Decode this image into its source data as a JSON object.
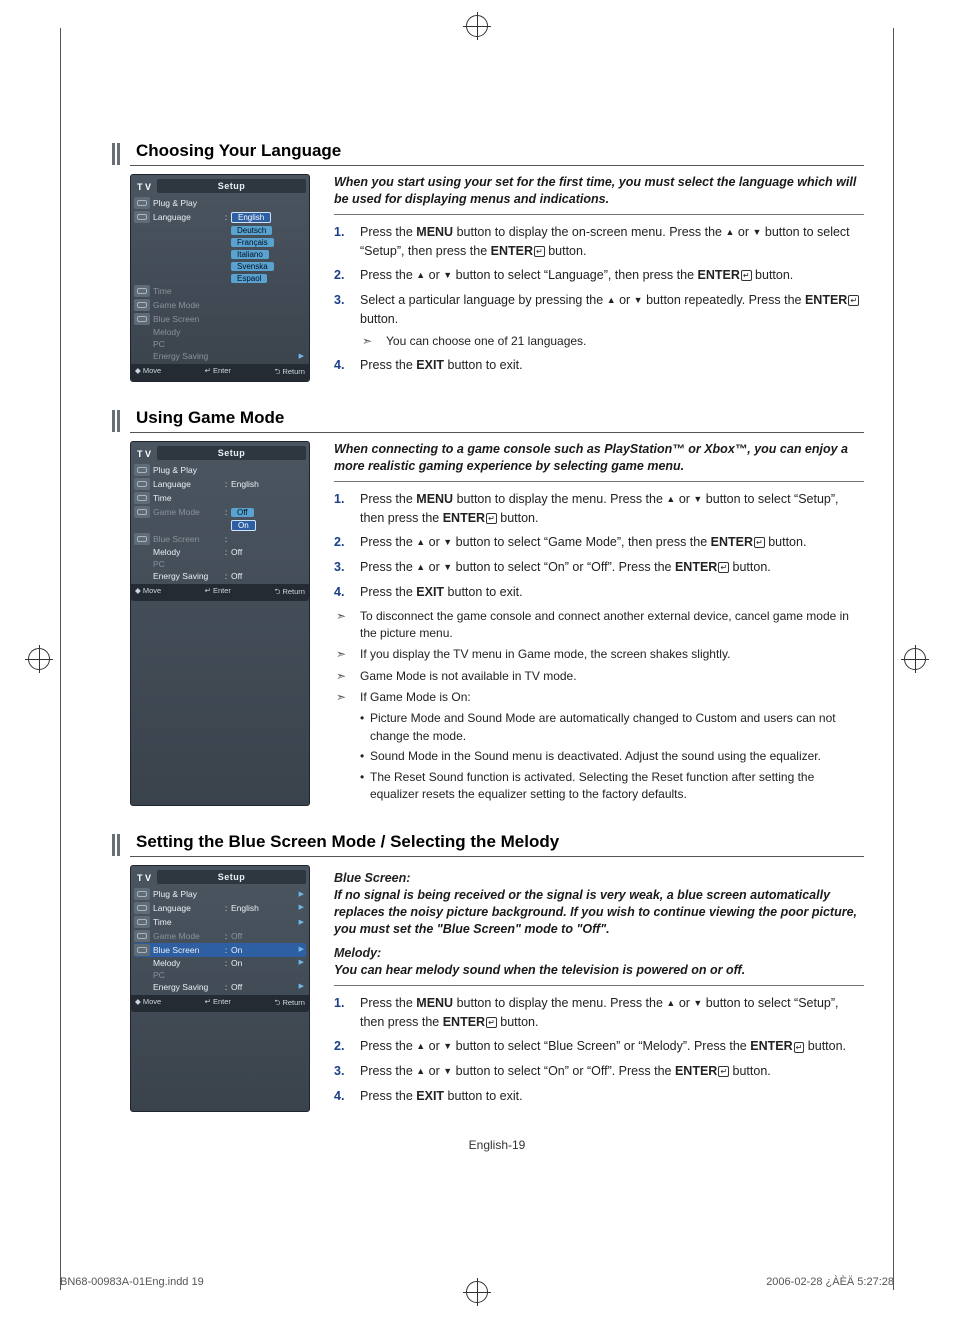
{
  "page_number_label": "English-19",
  "footer_left": "BN68-00983A-01Eng.indd   19",
  "footer_right": "2006-02-28   ¿ÀÈÄ 5:27:28",
  "sectionA": {
    "title": "Choosing Your Language",
    "intro": "When you start using your set for the first time, you must select the language which will be used for displaying menus and indications.",
    "steps": [
      "Press the <b>MENU</b> button to display the on-screen menu. Press the <span class='arw'>▲</span> or <span class='arw'>▼</span> button to select “Setup”, then press the <b>ENTER</b><span class='enter-ic'>↵</span> button.",
      "Press the <span class='arw'>▲</span> or <span class='arw'>▼</span> button to select “Language”, then press the <b>ENTER</b><span class='enter-ic'>↵</span> button.",
      "Select a particular language by pressing the <span class='arw'>▲</span> or <span class='arw'>▼</span> button repeatedly. Press the <b>ENTER</b><span class='enter-ic'>↵</span> button.<div class='note-line'>You can choose one of 21 languages.</div>",
      "Press the <b>EXIT</b> button to exit."
    ],
    "osd": {
      "tv": "T V",
      "header": "Setup",
      "rows": [
        {
          "label": "Plug & Play"
        },
        {
          "label": "Language",
          "col": ":",
          "options": [
            "English",
            "Deutsch",
            "Français",
            "Italiano",
            "Svenska",
            "Espaol"
          ],
          "selected": 0,
          "optionsMode": true
        },
        {
          "label": "Time",
          "dim": true
        },
        {
          "label": "Game Mode",
          "dim": true
        },
        {
          "label": "Blue Screen",
          "dim": true
        },
        {
          "label": "Melody",
          "dim": true
        },
        {
          "label": "PC",
          "dim": true
        },
        {
          "label": "Energy Saving",
          "dim": true,
          "chev": true
        }
      ],
      "foot": [
        "◆ Move",
        "↵ Enter",
        "⮌ Return"
      ]
    }
  },
  "sectionB": {
    "title": "Using Game Mode",
    "intro": "When connecting to a game console such as PlayStation™ or Xbox™, you can enjoy a more realistic gaming experience by selecting game menu.",
    "steps": [
      "Press the <b>MENU</b> button to display the menu. Press the <span class='arw'>▲</span> or <span class='arw'>▼</span> button to select “Setup”, then press the <b>ENTER</b><span class='enter-ic'>↵</span> button.",
      "Press the <span class='arw'>▲</span> or <span class='arw'>▼</span> button to select “Game Mode”, then press the <b>ENTER</b><span class='enter-ic'>↵</span> button.",
      "Press the <span class='arw'>▲</span> or <span class='arw'>▼</span> button to select “On” or “Off”. Press the <b>ENTER</b><span class='enter-ic'>↵</span> button.",
      "Press the <b>EXIT</b> button to exit."
    ],
    "notes": [
      "To disconnect the game console and connect another external device, cancel game mode in the picture menu.",
      "If you display the TV menu in Game mode, the screen shakes slightly.",
      "Game Mode is not available in TV mode.",
      "If Game Mode is On:"
    ],
    "sub_bullets": [
      "Picture Mode and Sound Mode are automatically changed to Custom and users can not change the mode.",
      "Sound Mode in the Sound menu is deactivated. Adjust the sound using the equalizer.",
      "The Reset Sound function is activated. Selecting the Reset function after setting the equalizer resets the equalizer setting to the factory defaults."
    ],
    "osd": {
      "tv": "T V",
      "header": "Setup",
      "rows": [
        {
          "label": "Plug & Play"
        },
        {
          "label": "Language",
          "col": ":",
          "val": "English"
        },
        {
          "label": "Time"
        },
        {
          "label": "Game Mode",
          "col": ":",
          "options": [
            "Off",
            "On"
          ],
          "selected": 1,
          "optionsMode": true,
          "labelDim": true
        },
        {
          "label": "Blue Screen",
          "col": ":",
          "dim": true
        },
        {
          "label": "Melody",
          "col": ":",
          "val": "Off"
        },
        {
          "label": "PC",
          "dim": true
        },
        {
          "label": "Energy Saving",
          "col": ":",
          "val": "Off"
        }
      ],
      "foot": [
        "◆ Move",
        "↵ Enter",
        "⮌ Return"
      ]
    }
  },
  "sectionC": {
    "title": "Setting the Blue Screen Mode / Selecting the Melody",
    "intro_title_1": "Blue Screen:",
    "intro_1": "If no signal is being received or the signal is very weak, a blue screen automatically replaces the noisy picture background. If you wish to continue viewing the poor picture, you must set the \"Blue Screen\" mode to \"Off\".",
    "intro_title_2": "Melody:",
    "intro_2": "You can hear melody sound when the television is powered on or off.",
    "steps": [
      "Press the <b>MENU</b> button to display the menu. Press the <span class='arw'>▲</span> or <span class='arw'>▼</span> button to select “Setup”, then press the <b>ENTER</b><span class='enter-ic'>↵</span> button.",
      "Press the <span class='arw'>▲</span> or <span class='arw'>▼</span> button to select “Blue Screen” or “Melody”. Press the <b>ENTER</b><span class='enter-ic'>↵</span> button.",
      "Press the <span class='arw'>▲</span> or <span class='arw'>▼</span> button to select “On” or “Off”. Press the <b>ENTER</b><span class='enter-ic'>↵</span> button.",
      "Press the <b>EXIT</b> button to exit."
    ],
    "osd": {
      "tv": "T V",
      "header": "Setup",
      "rows": [
        {
          "label": "Plug & Play",
          "chev": true
        },
        {
          "label": "Language",
          "col": ":",
          "val": "English",
          "chev": true
        },
        {
          "label": "Time",
          "chev": true
        },
        {
          "label": "Game Mode",
          "col": ":",
          "val": "Off",
          "dim": true
        },
        {
          "label": "Blue Screen",
          "col": ":",
          "val": "On",
          "hilite": true,
          "chev": true
        },
        {
          "label": "Melody",
          "col": ":",
          "val": "On",
          "chev": true
        },
        {
          "label": "PC",
          "dim": true
        },
        {
          "label": "Energy Saving",
          "col": ":",
          "val": "Off",
          "chev": true
        }
      ],
      "foot": [
        "◆ Move",
        "↵ Enter",
        "⮌ Return"
      ]
    }
  }
}
